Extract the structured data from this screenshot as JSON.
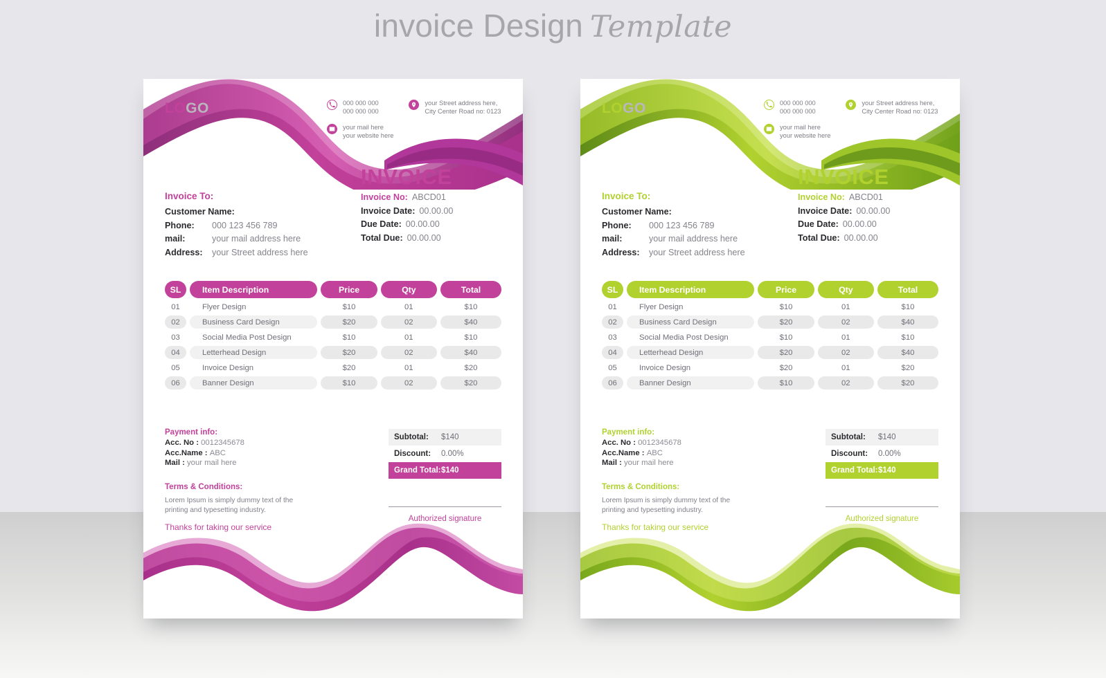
{
  "page": {
    "title_main": "invoice Design",
    "title_script": "Template",
    "background_top": "#E7E6EB",
    "background_bottom": "#D6D6D6"
  },
  "theme": {
    "pink": {
      "name": "pink",
      "accent": "#C2419A",
      "accent_dark": "#A8308A"
    },
    "green": {
      "name": "green",
      "accent": "#B1D12F",
      "accent_dark": "#8CB520"
    }
  },
  "invoice": {
    "logo": {
      "bold": "LO",
      "light": "GO"
    },
    "contacts": {
      "phone": {
        "line1": "000 000 000",
        "line2": "000 000 000",
        "icon": "phone-icon"
      },
      "mail": {
        "line1": "your mail here",
        "line2": "your website here",
        "icon": "mail-icon"
      },
      "address": {
        "line1": "your Street address here,",
        "line2": "City Center Road no: 0123",
        "icon": "location-pin-icon"
      }
    },
    "heading": "INVOICE",
    "bill_to": {
      "title": "Invoice To:",
      "rows": [
        {
          "label": "Customer Name:",
          "value": ""
        },
        {
          "label": "Phone:",
          "value": "000 123 456 789"
        },
        {
          "label": "mail:",
          "value": "your mail address here"
        },
        {
          "label": "Address:",
          "value": "your Street address here"
        }
      ]
    },
    "meta": {
      "rows": [
        {
          "label": "Invoice No:",
          "value": "ABCD01"
        },
        {
          "label": "Invoice Date:",
          "value": "00.00.00"
        },
        {
          "label": "Due Date:",
          "value": "00.00.00"
        },
        {
          "label": "Total Due:",
          "value": "00.00.00"
        }
      ]
    },
    "table": {
      "headers": {
        "sl": "SL",
        "desc": "Item Description",
        "price": "Price",
        "qty": "Qty",
        "total": "Total"
      },
      "rows": [
        {
          "sl": "01",
          "desc": "Flyer Design",
          "price": "$10",
          "qty": "01",
          "total": "$10"
        },
        {
          "sl": "02",
          "desc": "Business Card Design",
          "price": "$20",
          "qty": "02",
          "total": "$40"
        },
        {
          "sl": "03",
          "desc": "Social Media Post Design",
          "price": "$10",
          "qty": "01",
          "total": "$10"
        },
        {
          "sl": "04",
          "desc": "Letterhead Design",
          "price": "$20",
          "qty": "02",
          "total": "$40"
        },
        {
          "sl": "05",
          "desc": "Invoice Design",
          "price": "$20",
          "qty": "01",
          "total": "$20"
        },
        {
          "sl": "06",
          "desc": "Banner Design",
          "price": "$10",
          "qty": "02",
          "total": "$20"
        }
      ]
    },
    "payment": {
      "title": "Payment info:",
      "lines": [
        {
          "label": "Acc. No :",
          "value": "0012345678"
        },
        {
          "label": "Acc.Name :",
          "value": "ABC"
        },
        {
          "label": "Mail :",
          "value": "your mail here"
        }
      ]
    },
    "terms": {
      "title": "Terms & Conditions:",
      "body": "Lorem Ipsum is simply dummy text of the printing and typesetting industry."
    },
    "thanks": "Thanks for taking our service",
    "totals": {
      "subtotal": {
        "label": "Subtotal:",
        "value": "$140"
      },
      "discount": {
        "label": "Discount:",
        "value": "0.00%"
      },
      "grand_total": {
        "label": "Grand Total:",
        "value": "$140"
      }
    },
    "signature_label": "Authorized signature"
  }
}
